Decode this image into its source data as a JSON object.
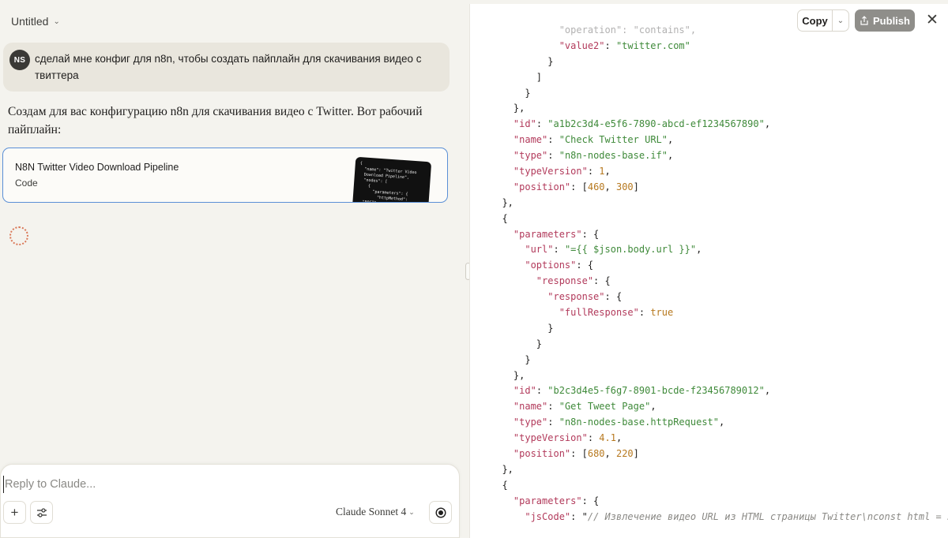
{
  "conversation": {
    "title": "Untitled",
    "user_initials": "NS",
    "user_message": "сделай мне конфиг для n8n,  чтобы создать пайплайн для скачивания видео с твиттера",
    "assistant_message": "Создам для вас конфигурацию n8n для скачивания видео с Twitter. Вот рабочий пайплайн:",
    "artifact": {
      "title": "N8N Twitter Video Download Pipeline",
      "kind": "Code",
      "thumbnail_text": "{\n  \"name\": \"Twitter Video\n  Download Pipeline\",\n  \"nodes\": [\n    {\n      \"parameters\": {\n        \"httpMethod\":\n  \"POST\",   \"path\": \"twitter-\n  video\"\n      },"
    }
  },
  "composer": {
    "placeholder": "Reply to Claude...",
    "value": "",
    "model": "Claude Sonnet 4"
  },
  "artifact_panel": {
    "copy_label": "Copy",
    "publish_label": "Publish",
    "code_lines": [
      [
        {
          "t": "            \"operation\": \"contains\",",
          "c": "faded"
        }
      ],
      [
        {
          "t": "            "
        },
        {
          "t": "\"value2\"",
          "c": "k"
        },
        {
          "t": ": "
        },
        {
          "t": "\"twitter.com\"",
          "c": "s"
        }
      ],
      [
        {
          "t": "          }"
        }
      ],
      [
        {
          "t": "        ]"
        }
      ],
      [
        {
          "t": "      }"
        }
      ],
      [
        {
          "t": "    },"
        }
      ],
      [
        {
          "t": "    "
        },
        {
          "t": "\"id\"",
          "c": "k"
        },
        {
          "t": ": "
        },
        {
          "t": "\"a1b2c3d4-e5f6-7890-abcd-ef1234567890\"",
          "c": "s"
        },
        {
          "t": ","
        }
      ],
      [
        {
          "t": "    "
        },
        {
          "t": "\"name\"",
          "c": "k"
        },
        {
          "t": ": "
        },
        {
          "t": "\"Check Twitter URL\"",
          "c": "s"
        },
        {
          "t": ","
        }
      ],
      [
        {
          "t": "    "
        },
        {
          "t": "\"type\"",
          "c": "k"
        },
        {
          "t": ": "
        },
        {
          "t": "\"n8n-nodes-base.if\"",
          "c": "s"
        },
        {
          "t": ","
        }
      ],
      [
        {
          "t": "    "
        },
        {
          "t": "\"typeVersion\"",
          "c": "k"
        },
        {
          "t": ": "
        },
        {
          "t": "1",
          "c": "n"
        },
        {
          "t": ","
        }
      ],
      [
        {
          "t": "    "
        },
        {
          "t": "\"position\"",
          "c": "k"
        },
        {
          "t": ": ["
        },
        {
          "t": "460",
          "c": "n"
        },
        {
          "t": ", "
        },
        {
          "t": "300",
          "c": "n"
        },
        {
          "t": "]"
        }
      ],
      [
        {
          "t": "  },"
        }
      ],
      [
        {
          "t": "  {"
        }
      ],
      [
        {
          "t": "    "
        },
        {
          "t": "\"parameters\"",
          "c": "k"
        },
        {
          "t": ": {"
        }
      ],
      [
        {
          "t": "      "
        },
        {
          "t": "\"url\"",
          "c": "k"
        },
        {
          "t": ": "
        },
        {
          "t": "\"={{ $json.body.url }}\"",
          "c": "s"
        },
        {
          "t": ","
        }
      ],
      [
        {
          "t": "      "
        },
        {
          "t": "\"options\"",
          "c": "k"
        },
        {
          "t": ": {"
        }
      ],
      [
        {
          "t": "        "
        },
        {
          "t": "\"response\"",
          "c": "k"
        },
        {
          "t": ": {"
        }
      ],
      [
        {
          "t": "          "
        },
        {
          "t": "\"response\"",
          "c": "k"
        },
        {
          "t": ": {"
        }
      ],
      [
        {
          "t": "            "
        },
        {
          "t": "\"fullResponse\"",
          "c": "k"
        },
        {
          "t": ": "
        },
        {
          "t": "true",
          "c": "n"
        }
      ],
      [
        {
          "t": "          }"
        }
      ],
      [
        {
          "t": "        }"
        }
      ],
      [
        {
          "t": "      }"
        }
      ],
      [
        {
          "t": "    },"
        }
      ],
      [
        {
          "t": "    "
        },
        {
          "t": "\"id\"",
          "c": "k"
        },
        {
          "t": ": "
        },
        {
          "t": "\"b2c3d4e5-f6g7-8901-bcde-f23456789012\"",
          "c": "s"
        },
        {
          "t": ","
        }
      ],
      [
        {
          "t": "    "
        },
        {
          "t": "\"name\"",
          "c": "k"
        },
        {
          "t": ": "
        },
        {
          "t": "\"Get Tweet Page\"",
          "c": "s"
        },
        {
          "t": ","
        }
      ],
      [
        {
          "t": "    "
        },
        {
          "t": "\"type\"",
          "c": "k"
        },
        {
          "t": ": "
        },
        {
          "t": "\"n8n-nodes-base.httpRequest\"",
          "c": "s"
        },
        {
          "t": ","
        }
      ],
      [
        {
          "t": "    "
        },
        {
          "t": "\"typeVersion\"",
          "c": "k"
        },
        {
          "t": ": "
        },
        {
          "t": "4.1",
          "c": "n"
        },
        {
          "t": ","
        }
      ],
      [
        {
          "t": "    "
        },
        {
          "t": "\"position\"",
          "c": "k"
        },
        {
          "t": ": ["
        },
        {
          "t": "680",
          "c": "n"
        },
        {
          "t": ", "
        },
        {
          "t": "220",
          "c": "n"
        },
        {
          "t": "]"
        }
      ],
      [
        {
          "t": "  },"
        }
      ],
      [
        {
          "t": "  {"
        }
      ],
      [
        {
          "t": "    "
        },
        {
          "t": "\"parameters\"",
          "c": "k"
        },
        {
          "t": ": {"
        }
      ],
      [
        {
          "t": "      "
        },
        {
          "t": "\"jsCode\"",
          "c": "k"
        },
        {
          "t": ": \""
        },
        {
          "t": "// Извлечение видео URL из HTML страницы Twitter\\nconst html = $input",
          "c": "c"
        }
      ]
    ]
  },
  "colors": {
    "accent_orange": "#d97757",
    "artifact_border": "#5a8fd6",
    "json_key": "#b23a5b",
    "json_string": "#3f8a3a",
    "json_number": "#b7791f"
  }
}
